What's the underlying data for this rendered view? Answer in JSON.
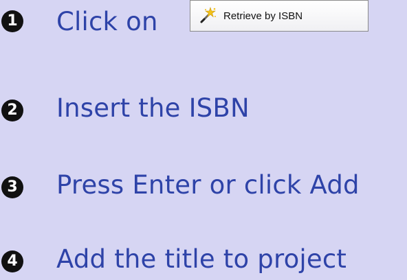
{
  "steps": [
    {
      "number": "1",
      "text": "Click on"
    },
    {
      "number": "2",
      "text": "Insert the ISBN"
    },
    {
      "number": "3",
      "text": "Press Enter or click Add"
    },
    {
      "number": "4",
      "text": "Add the title to project"
    }
  ],
  "retrieve_button": {
    "label": "Retrieve by ISBN",
    "icon": "magic-wand-icon"
  },
  "colors": {
    "background": "#d6d5f3",
    "step_text": "#2e43a8",
    "badge": "#111111"
  }
}
